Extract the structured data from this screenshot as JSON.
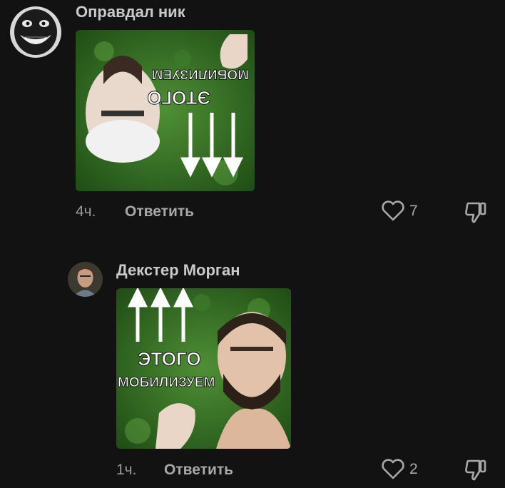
{
  "comments": [
    {
      "username": "Оправдал ник",
      "avatar_icon": "troll-face-avatar",
      "image": {
        "line1": "ЭТОГО",
        "line2": "МОБИЛИЗУЕМ",
        "orientation": "upside-down"
      },
      "time": "4ч.",
      "reply_label": "Ответить",
      "likes": "7"
    },
    {
      "username": "Декстер Морган",
      "avatar_icon": "man-portrait-avatar",
      "image": {
        "line1": "ЭТОГО",
        "line2": "МОБИЛИЗУЕМ",
        "orientation": "normal"
      },
      "time": "1ч.",
      "reply_label": "Ответить",
      "likes": "2"
    }
  ],
  "colors": {
    "background": "#121212",
    "meme_green": "#2f6b1f",
    "text_muted": "#a8a8a8"
  }
}
